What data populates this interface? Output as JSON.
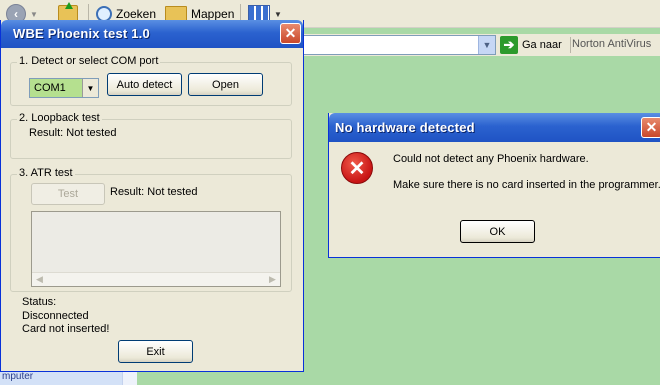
{
  "explorer": {
    "toolbar": {
      "search_label": "Zoeken",
      "folders_label": "Mappen"
    },
    "address": {
      "go_label": "Ga naar",
      "norton_label": "Norton AntiVirus"
    },
    "computer_label": "mputer"
  },
  "app": {
    "title": "WBE Phoenix test 1.0",
    "close_glyph": "✕",
    "com_group": {
      "label": "1. Detect or select COM port",
      "port_value": "COM1",
      "auto_detect_label": "Auto detect",
      "open_label": "Open"
    },
    "loopback_group": {
      "label": "2. Loopback test",
      "result": "Result: Not tested"
    },
    "atr_group": {
      "label": "3. ATR test",
      "test_label": "Test",
      "result": "Result: Not tested"
    },
    "status": {
      "heading": "Status:",
      "line1": "Disconnected",
      "line2": "Card not inserted!"
    },
    "exit_label": "Exit"
  },
  "dialog": {
    "title": "No hardware detected",
    "close_glyph": "✕",
    "message1": "Could not detect any Phoenix hardware.",
    "message2": "Make sure there is no card inserted in the programmer.",
    "ok_label": "OK",
    "error_glyph": "✕"
  },
  "colors": {
    "desktop": "#a9d9a6",
    "title_blue": "#2b62cf",
    "combo_green": "#b5e08f",
    "error_red": "#c81414"
  }
}
